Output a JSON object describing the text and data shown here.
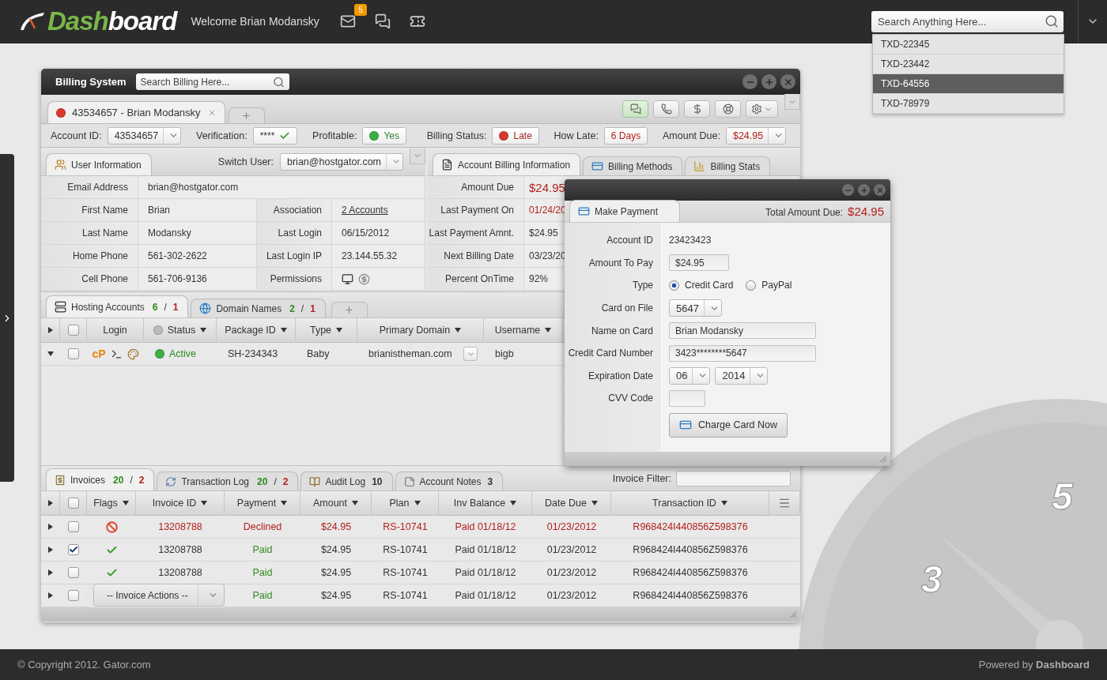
{
  "header": {
    "logo": {
      "accent": "Dash",
      "rest": "board"
    },
    "welcome": "Welcome Brian Modansky",
    "mail_badge": "5",
    "search": {
      "placeholder": "Search Anything Here..."
    }
  },
  "search_results": [
    {
      "label": "TXD-22345",
      "selected": false
    },
    {
      "label": "TXD-23442",
      "selected": false
    },
    {
      "label": "TXD-64556",
      "selected": true
    },
    {
      "label": "TXD-78979",
      "selected": false
    }
  ],
  "billing": {
    "title": "Billing System",
    "search": {
      "placeholder": "Search Billing Here..."
    },
    "customer_tab": {
      "label": "43534657 - Brian Modansky",
      "selected": true,
      "color": "#d9382c"
    },
    "toolbar": [
      {
        "kind": "chat",
        "selected": true
      },
      {
        "kind": "phone",
        "selected": false
      },
      {
        "kind": "dollar",
        "selected": false
      },
      {
        "kind": "support",
        "selected": false
      },
      {
        "kind": "settings",
        "selected": false
      }
    ]
  },
  "summary_left": [
    {
      "kind": "select",
      "label": "Account ID:",
      "value": "43534657",
      "alert": false
    },
    {
      "kind": "verified",
      "label": "Verification:",
      "value": "****"
    },
    {
      "kind": "status",
      "label": "Profitable:",
      "value": "Yes",
      "color": "#3cb043"
    }
  ],
  "summary_right": [
    {
      "kind": "status",
      "label": "Billing Status:",
      "value": "Late",
      "color": "#d9382c"
    },
    {
      "kind": "plain",
      "label": "How Late:",
      "value": "6 Days",
      "alert": true
    },
    {
      "kind": "select",
      "label": "Amount Due:",
      "value": "$24.95",
      "alert": true
    }
  ],
  "user_info": {
    "tab": {
      "label": "User Information",
      "selected": true
    },
    "switch_label": "Switch User:",
    "switch_value": "brian@hostgator.com",
    "email": {
      "label": "Email Address",
      "value": "brian@hostgator.com"
    },
    "rows": [
      {
        "label": "First Name",
        "value": "Brian",
        "detail": {
          "kind": "link",
          "label": "Association",
          "value": "2 Accounts"
        }
      },
      {
        "label": "Last Name",
        "value": "Modansky",
        "detail": {
          "kind": "text",
          "label": "Last Login",
          "value": "06/15/2012"
        }
      },
      {
        "label": "Home Phone",
        "value": "561-302-2622",
        "detail": {
          "kind": "text",
          "label": "Last Login IP",
          "value": "23.144.55.32"
        }
      },
      {
        "label": "Cell Phone",
        "value": "561-706-9136",
        "detail": {
          "kind": "icons",
          "label": "Permissions"
        }
      }
    ]
  },
  "billing_info": {
    "tabs": [
      {
        "kind": "document",
        "label": "Account Billing Information",
        "selected": true
      },
      {
        "kind": "card",
        "label": "Billing Methods",
        "selected": false
      },
      {
        "kind": "chart",
        "label": "Billing Stats",
        "selected": false
      }
    ],
    "rows": [
      {
        "label": "Amount Due",
        "value": "$24.95",
        "alert": true,
        "large": true
      },
      {
        "label": "Last Payment On",
        "value": "01/24/20",
        "alert": true,
        "large": false
      },
      {
        "label": "Last Payment Amnt.",
        "value": "$24.95",
        "alert": false,
        "large": false
      },
      {
        "label": "Next Billing Date",
        "value": "03/23/20",
        "alert": false,
        "large": false
      },
      {
        "label": "Percent OnTime",
        "value": "92%",
        "alert": false,
        "large": false
      }
    ]
  },
  "hosting": {
    "tabs": [
      {
        "kind": "server",
        "label": "Hosting Accounts",
        "count": "6",
        "separator": "/",
        "errors": "1",
        "selected": true
      },
      {
        "kind": "globe",
        "label": "Domain Names",
        "count": "2",
        "separator": "/",
        "errors": "1",
        "selected": false
      }
    ],
    "all_checked": false,
    "columns": [
      {
        "label": "Login",
        "sortable": false
      },
      {
        "label": "Status",
        "sortable": true
      },
      {
        "label": "Package ID",
        "sortable": true
      },
      {
        "label": "Type",
        "sortable": true
      },
      {
        "label": "Primary Domain",
        "sortable": true
      },
      {
        "label": "Username",
        "sortable": true
      }
    ],
    "rows": [
      {
        "expanded": true,
        "checked": false,
        "login_mark": "cP",
        "status": "Active",
        "color": "#3cb043",
        "package_id": "SH-234343",
        "type": "Baby",
        "domain": "brianistheman.com",
        "username": "bigb"
      }
    ]
  },
  "invoices": {
    "tabs": [
      {
        "kind": "invoice",
        "label": "Invoices",
        "count": "20",
        "separator": "/",
        "errors": "2",
        "selected": true
      },
      {
        "kind": "refresh",
        "label": "Transaction Log",
        "count": "20",
        "separator": "/",
        "errors": "2",
        "selected": false
      },
      {
        "kind": "book",
        "label": "Audit Log",
        "count": "10",
        "selected": false
      },
      {
        "kind": "note",
        "label": "Account Notes",
        "count": "3",
        "selected": false
      }
    ],
    "filter_label": "Invoice Filter:",
    "all_checked": false,
    "columns": [
      {
        "label": "Flags",
        "sortable": true
      },
      {
        "label": "Invoice ID",
        "sortable": true
      },
      {
        "label": "Payment",
        "sortable": true
      },
      {
        "label": "Amount",
        "sortable": true
      },
      {
        "label": "Plan",
        "sortable": true
      },
      {
        "label": "Inv Balance",
        "sortable": true
      },
      {
        "label": "Date Due",
        "sortable": true
      },
      {
        "label": "Transaction ID",
        "sortable": true
      }
    ],
    "rows": [
      {
        "kind": "declined",
        "expanded": false,
        "checked": false,
        "invoice_id": "13208788",
        "payment": "Declined",
        "amount": "$24.95",
        "plan": "RS-10741",
        "balance": "Paid 01/18/12",
        "date_due": "01/23/2012",
        "transaction_id": "R968424I440856Z598376"
      },
      {
        "kind": "paid",
        "expanded": false,
        "checked": true,
        "invoice_id": "13208788",
        "payment": "Paid",
        "amount": "$24.95",
        "plan": "RS-10741",
        "balance": "Paid 01/18/12",
        "date_due": "01/23/2012",
        "transaction_id": "R968424I440856Z598376"
      },
      {
        "kind": "paid",
        "expanded": false,
        "checked": false,
        "invoice_id": "13208788",
        "payment": "Paid",
        "amount": "$24.95",
        "plan": "RS-10741",
        "balance": "Paid 01/18/12",
        "date_due": "01/23/2012",
        "transaction_id": "R968424I440856Z598376"
      },
      {
        "kind": "menu",
        "expanded": false,
        "checked": false,
        "actions_menu": "-- Invoice Actions --",
        "payment": "Paid",
        "amount": "$24.95",
        "plan": "RS-10741",
        "balance": "Paid 01/18/12",
        "date_due": "01/23/2012",
        "transaction_id": "R968424I440856Z598376"
      }
    ]
  },
  "payment": {
    "tab": {
      "label": "Make Payment",
      "selected": true
    },
    "total_label": "Total Amount Due:",
    "total": "$24.95",
    "fields": [
      {
        "kind": "static",
        "label": "Account ID",
        "value": "23423423"
      },
      {
        "kind": "amount",
        "label": "Amount To Pay",
        "value": "$24.95"
      },
      {
        "kind": "radio",
        "label": "Type",
        "options": [
          {
            "label": "Credit Card",
            "selected": true
          },
          {
            "label": "PayPal",
            "selected": false
          }
        ]
      },
      {
        "kind": "select",
        "label": "Card on File",
        "values": [
          "5647"
        ]
      },
      {
        "kind": "input",
        "label": "Name on Card",
        "value": "Brian Modansky"
      },
      {
        "kind": "input",
        "label": "Credit Card Number",
        "value": "3423********5647"
      },
      {
        "kind": "select",
        "label": "Expiration Date",
        "values": [
          "06",
          "2014"
        ]
      },
      {
        "kind": "code",
        "label": "CVV Code"
      }
    ],
    "button": "Charge Card Now"
  },
  "gauge": {
    "numerals": [
      "5",
      "3"
    ]
  },
  "footer": {
    "copyright": "© Copyright 2012. Gator.com",
    "powered": "Powered by **Dashboard**"
  }
}
